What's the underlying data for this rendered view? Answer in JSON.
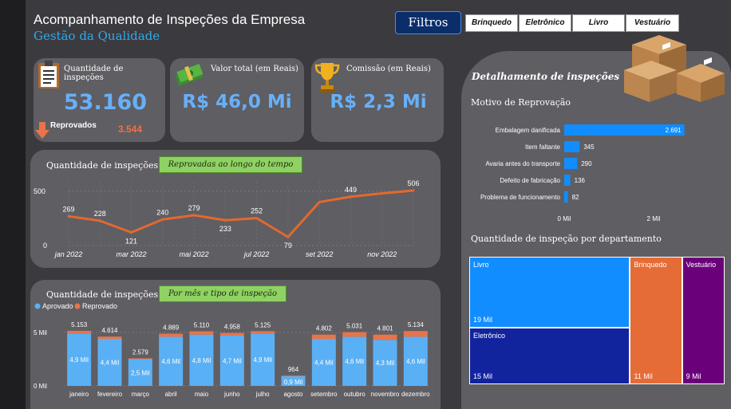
{
  "header": {
    "title": "Acompanhamento de Inspeções da Empresa",
    "subtitle": "Gestão da Qualidade",
    "filter_button": "Filtros",
    "chips": [
      "Brinquedo",
      "Eletrônico",
      "Livro",
      "Vestuário"
    ]
  },
  "kpis": {
    "inspecoes": {
      "label": "Quantidade de inspeções",
      "value": "53.160",
      "sub_label": "Reprovados",
      "sub_value": "3.544"
    },
    "valor": {
      "label": "Valor total (em Reais)",
      "value": "R$ 46,0 Mi"
    },
    "comissao": {
      "label": "Comissão (em Reais)",
      "value": "R$ 2,3 Mi"
    }
  },
  "line_panel": {
    "title": "Quantidade de inspeções",
    "pill": "Reprovadas ao longo do tempo"
  },
  "bar_panel": {
    "title": "Quantidade de inspeções",
    "pill": "Por mês e tipo de inspeção"
  },
  "detail_panel": {
    "title": "Detalhamento de inspeções",
    "motivo_title": "Motivo de Reprovação",
    "dept_title": "Quantidade de inspeção por departamento"
  },
  "colors": {
    "accent_blue": "#118dff",
    "approved": "#5ab0f5",
    "rejected": "#e8744a",
    "line": "#e2692e",
    "treemap_livro": "#118dff",
    "treemap_eletronico": "#12239e",
    "treemap_brinquedo": "#e66c37",
    "treemap_vestuario": "#6b007b"
  },
  "chart_data": [
    {
      "type": "line",
      "x": [
        "jan 2022",
        "fev 2022",
        "mar 2022",
        "abr 2022",
        "mai 2022",
        "jun 2022",
        "jul 2022",
        "ago 2022",
        "set 2022",
        "out 2022",
        "nov 2022",
        "dez 2022"
      ],
      "x_tick_labels": [
        "jan 2022",
        "mar 2022",
        "mai 2022",
        "jul 2022",
        "set 2022",
        "nov 2022"
      ],
      "values": [
        269,
        228,
        121,
        240,
        279,
        233,
        252,
        79,
        400,
        449,
        480,
        506
      ],
      "data_labels": [
        "269",
        "228",
        "121",
        "240",
        "279",
        "233",
        "252",
        "79",
        "",
        "449",
        "",
        "506"
      ],
      "y_ticks": [
        "0",
        "500"
      ],
      "ylim": [
        0,
        550
      ],
      "grid": true
    },
    {
      "type": "bar",
      "stacked": true,
      "categories": [
        "janeiro",
        "fevereiro",
        "março",
        "abril",
        "maio",
        "junho",
        "julho",
        "agosto",
        "setembro",
        "outubro",
        "novembro",
        "dezembro"
      ],
      "series": [
        {
          "name": "Aprovado",
          "values": [
            4900,
            4400,
            2500,
            4600,
            4800,
            4700,
            4900,
            900,
            4400,
            4600,
            4300,
            4600
          ],
          "labels": [
            "4,9 Mil",
            "4,4 Mil",
            "2,5 Mil",
            "4,6 Mil",
            "4,8 Mil",
            "4,7 Mil",
            "4,9 Mil",
            "0,9 Mil",
            "4,4 Mil",
            "4,6 Mil",
            "4,3 Mil",
            "4,6 Mil"
          ]
        },
        {
          "name": "Reprovado",
          "values": [
            253,
            214,
            79,
            289,
            310,
            258,
            225,
            64,
            402,
            431,
            501,
            534
          ]
        }
      ],
      "totals": [
        "5.153",
        "4.614",
        "2.579",
        "4.889",
        "5.110",
        "4.958",
        "5.125",
        "964",
        "4.802",
        "5.031",
        "4.801",
        "5.134"
      ],
      "y_ticks": [
        "0 Mil",
        "5 Mil"
      ],
      "ylim": [
        0,
        5500
      ],
      "grid": true,
      "legend": "top-left"
    },
    {
      "type": "bar",
      "orientation": "horizontal",
      "categories": [
        "Embalagem danificada",
        "Item faltante",
        "Avaria antes do transporte",
        "Defeito de fabricação",
        "Problema de funcionamento"
      ],
      "values": [
        2691,
        345,
        290,
        136,
        82
      ],
      "labels": [
        "2.691",
        "345",
        "290",
        "136",
        "82"
      ],
      "x_ticks": [
        "0 Mil",
        "2 Mil"
      ],
      "xlim": [
        0,
        3000
      ]
    },
    {
      "type": "treemap",
      "items": [
        {
          "name": "Livro",
          "value": 19000,
          "label": "19 Mil"
        },
        {
          "name": "Eletrônico",
          "value": 15000,
          "label": "15 Mil"
        },
        {
          "name": "Brinquedo",
          "value": 11000,
          "label": "11 Mil"
        },
        {
          "name": "Vestuário",
          "value": 9000,
          "label": "9 Mil"
        }
      ]
    }
  ]
}
